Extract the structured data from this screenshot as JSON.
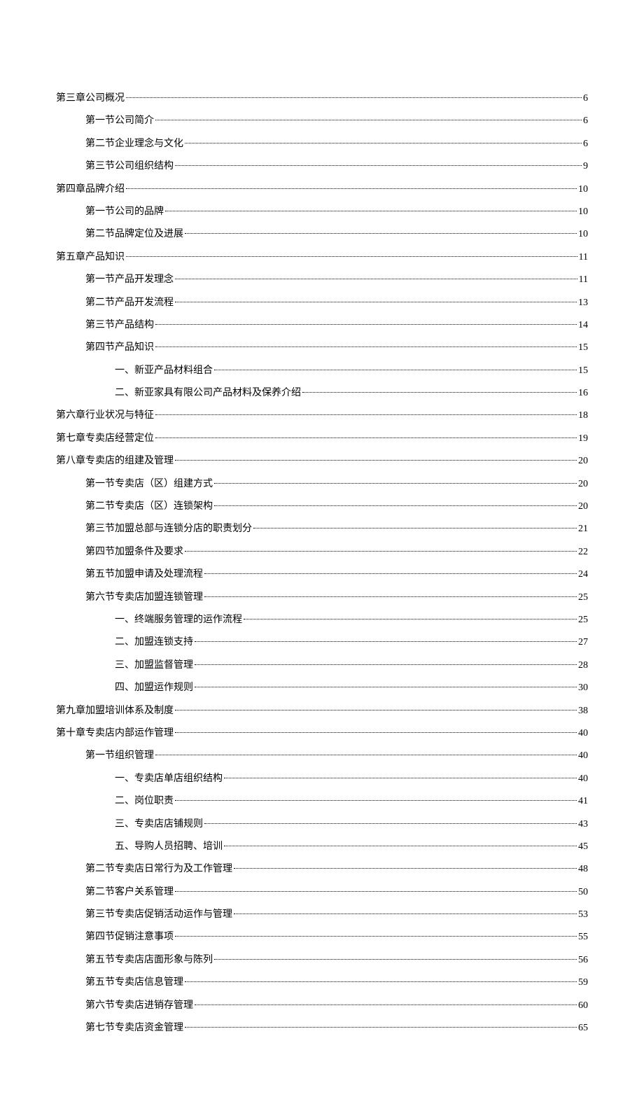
{
  "toc": [
    {
      "indent": 0,
      "title": "第三章公司概况",
      "page": "6"
    },
    {
      "indent": 1,
      "title": "第一节公司简介",
      "page": "6"
    },
    {
      "indent": 1,
      "title": "第二节企业理念与文化",
      "page": "6"
    },
    {
      "indent": 1,
      "title": "第三节公司组织结构",
      "page": "9"
    },
    {
      "indent": 0,
      "title": "第四章品牌介绍",
      "page": "10"
    },
    {
      "indent": 1,
      "title": "第一节公司的品牌",
      "page": "10"
    },
    {
      "indent": 1,
      "title": "第二节品牌定位及进展",
      "page": "10"
    },
    {
      "indent": 0,
      "title": "第五章产品知识",
      "page": "11"
    },
    {
      "indent": 1,
      "title": "第一节产品开发理念",
      "page": "11"
    },
    {
      "indent": 1,
      "title": "第二节产品开发流程",
      "page": "13"
    },
    {
      "indent": 1,
      "title": "第三节产品结构",
      "page": "14"
    },
    {
      "indent": 1,
      "title": "第四节产品知识",
      "page": "15"
    },
    {
      "indent": 2,
      "title": "一、新亚产品材料组合",
      "page": "15"
    },
    {
      "indent": 2,
      "title": "二、新亚家具有限公司产品材料及保养介绍",
      "page": "16"
    },
    {
      "indent": 0,
      "title": "第六章行业状况与特征",
      "page": "18"
    },
    {
      "indent": 0,
      "title": "第七章专卖店经营定位",
      "page": "19"
    },
    {
      "indent": 0,
      "title": "第八章专卖店的组建及管理",
      "page": "20"
    },
    {
      "indent": 1,
      "title": "第一节专卖店（区）组建方式",
      "page": "20"
    },
    {
      "indent": 1,
      "title": "第二节专卖店（区）连锁架构",
      "page": "20"
    },
    {
      "indent": 1,
      "title": "第三节加盟总部与连锁分店的职责划分",
      "page": "21"
    },
    {
      "indent": 1,
      "title": "第四节加盟条件及要求",
      "page": "22"
    },
    {
      "indent": 1,
      "title": "第五节加盟申请及处理流程",
      "page": "24"
    },
    {
      "indent": 1,
      "title": "第六节专卖店加盟连锁管理",
      "page": "25"
    },
    {
      "indent": 2,
      "title": "一、终端服务管理的运作流程",
      "page": "25"
    },
    {
      "indent": 2,
      "title": "二、加盟连锁支持",
      "page": "27"
    },
    {
      "indent": 2,
      "title": "三、加盟监督管理",
      "page": "28"
    },
    {
      "indent": 2,
      "title": "四、加盟运作规则",
      "page": "30"
    },
    {
      "indent": 0,
      "title": "第九章加盟培训体系及制度",
      "page": "38"
    },
    {
      "indent": 0,
      "title": "第十章专卖店内部运作管理",
      "page": "40"
    },
    {
      "indent": 1,
      "title": "第一节组织管理",
      "page": "40"
    },
    {
      "indent": 2,
      "title": "一、专卖店单店组织结构",
      "page": "40"
    },
    {
      "indent": 2,
      "title": "二、岗位职责",
      "page": "41"
    },
    {
      "indent": 2,
      "title": "三、专卖店店铺规则",
      "page": "43"
    },
    {
      "indent": 2,
      "title": "五、导购人员招聘、培训",
      "page": "45"
    },
    {
      "indent": 1,
      "title": "第二节专卖店日常行为及工作管理",
      "page": "48"
    },
    {
      "indent": 1,
      "title": "第二节客户关系管理",
      "page": "50"
    },
    {
      "indent": 1,
      "title": "第三节专卖店促销活动运作与管理",
      "page": "53"
    },
    {
      "indent": 1,
      "title": "第四节促销注意事项",
      "page": "55"
    },
    {
      "indent": 1,
      "title": "第五节专卖店店面形象与陈列",
      "page": "56"
    },
    {
      "indent": 1,
      "title": "第五节专卖店信息管理",
      "page": "59"
    },
    {
      "indent": 1,
      "title": "第六节专卖店进销存管理",
      "page": "60"
    },
    {
      "indent": 1,
      "title": "第七节专卖店资金管理",
      "page": "65"
    }
  ]
}
